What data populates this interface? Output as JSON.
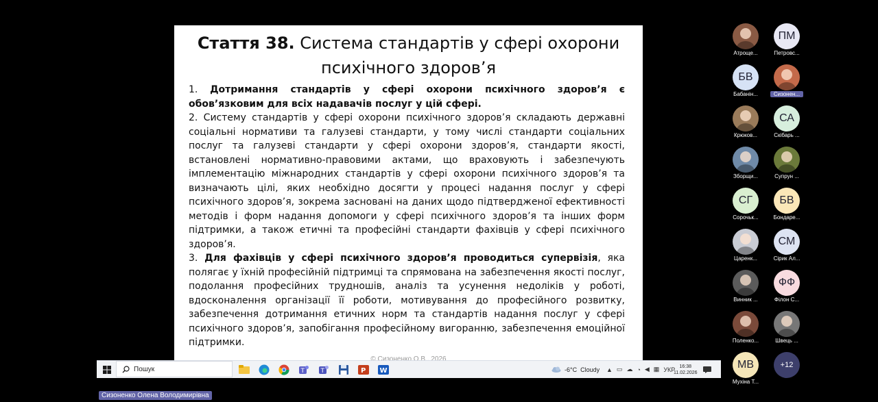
{
  "slide": {
    "title_bold": "Стаття 38.",
    "title_rest": " Система стандартів у сфері охорони психічного здоров’я",
    "p1_num": "1. ",
    "p1_bold": "Дотримання стандартів у сфері охорони психічного здоров’я є обов’язковим для всіх надавачів послуг у цій сфері.",
    "p2": "2. Систему стандартів у сфері охорони психічного здоров’я складають державні соціальні нормативи та галузеві стандарти, у тому числі стандарти соціальних послуг та галузеві стандарти у сфері охорони здоров’я, стандарти якості, встановлені нормативно-правовими актами, що враховують і забезпечують імплементацію міжнародних стандартів у сфері охорони психічного здоров’я та визначають цілі, яких необхідно досягти у процесі надання послуг у сфері психічного здоров’я, зокрема засновані на даних щодо підтвердженої ефективності методів і форм надання допомоги у сфері психічного здоров’я та інших форм підтримки, а також етичні та професійні стандарти фахівців у сфері психічного здоров’я.",
    "p3_num": "3. ",
    "p3_bold": "Для фахівців у сфері психічного здоров’я проводиться супервізія",
    "p3_rest": ", яка полягає у їхній професійній підтримці та спрямована на забезпечення якості послуг, подолання професійних трудношів, аналіз та усунення недоліків у роботі, вдосконалення організації її роботи, мотивування до професійного розвитку, забезпечення дотримання етичних норм та стандартів надання послуг у сфері психічного здоров’я, запобігання професійному вигоранню, забезпечення емоційної підтримки.",
    "footer": "© Сизоненко О.В., 2026"
  },
  "taskbar": {
    "search_label": "Пошук",
    "weather_temp": "-6°C",
    "weather_desc": "Cloudy",
    "lang": "УКР",
    "time": "16:38",
    "date": "11.02.2026"
  },
  "participants": [
    {
      "name": "Атроще...",
      "initials": "",
      "color": "#8a5a44"
    },
    {
      "name": "Петровс...",
      "initials": "ПМ",
      "color": "#e8e8f4"
    },
    {
      "name": "Бабанін...",
      "initials": "БВ",
      "color": "#d6e2f5"
    },
    {
      "name": "Сизонен...",
      "initials": "",
      "color": "#c46a4a"
    },
    {
      "name": "Крюков...",
      "initials": "",
      "color": "#9a7b5a"
    },
    {
      "name": "Скібарь ...",
      "initials": "СА",
      "color": "#d7eedd"
    },
    {
      "name": "Зборщи...",
      "initials": "",
      "color": "#6f8aa8"
    },
    {
      "name": "Супрун ...",
      "initials": "",
      "color": "#6b7a3a"
    },
    {
      "name": "Сорочьк...",
      "initials": "СГ",
      "color": "#d9efd0"
    },
    {
      "name": "Бондаре...",
      "initials": "БВ",
      "color": "#fbe7b8"
    },
    {
      "name": "Царенк...",
      "initials": "",
      "color": "#c9ccd4"
    },
    {
      "name": "Сірик Ал...",
      "initials": "СМ",
      "color": "#dde3f2"
    },
    {
      "name": "Винник ...",
      "initials": "",
      "color": "#5b5b5b"
    },
    {
      "name": "Філон С...",
      "initials": "ФФ",
      "color": "#f8dbe0"
    },
    {
      "name": "Поленко...",
      "initials": "",
      "color": "#7a4a3a"
    },
    {
      "name": "Швець ...",
      "initials": "",
      "color": "#777777"
    },
    {
      "name": "Мухіна Т...",
      "initials": "МВ",
      "color": "#f5e6b8"
    },
    {
      "name": "",
      "initials": "+12",
      "color": "#3d3f6b"
    }
  ],
  "speaker_name": "Сизоненко Олена Володимирівна"
}
